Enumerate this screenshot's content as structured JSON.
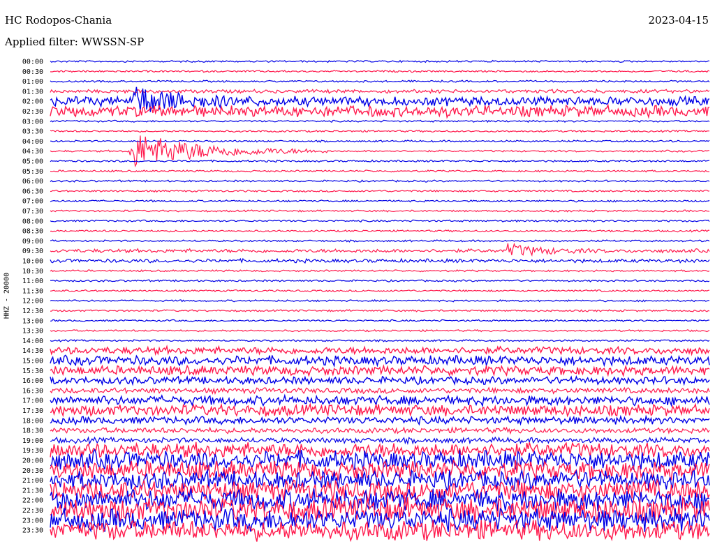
{
  "header": {
    "station": "HC Rodopos-Chania",
    "date": "2023-04-15",
    "filter": "Applied filter: WWSSN-SP",
    "channel": "HHZ - 20000"
  },
  "colors": {
    "odd": "#0000e6",
    "even": "#ff1a4d"
  },
  "chart_data": {
    "type": "helicorder",
    "title": "HC Rodopos-Chania",
    "date": "2023-04-15",
    "filter": "WWSSN-SP",
    "ylabel": "HHZ - 20000",
    "row_minutes": 30,
    "y_tick_labels": [
      "00:00",
      "00:30",
      "01:00",
      "01:30",
      "02:00",
      "02:30",
      "03:00",
      "03:30",
      "04:00",
      "04:30",
      "05:00",
      "05:30",
      "06:00",
      "06:30",
      "07:00",
      "07:30",
      "08:00",
      "08:30",
      "09:00",
      "09:30",
      "10:00",
      "10:30",
      "11:00",
      "11:30",
      "12:00",
      "12:30",
      "13:00",
      "13:30",
      "14:00",
      "14:30",
      "15:00",
      "15:30",
      "16:00",
      "16:30",
      "17:00",
      "17:30",
      "18:00",
      "18:30",
      "19:00",
      "19:30",
      "20:00",
      "20:30",
      "21:00",
      "21:30",
      "22:00",
      "22:30",
      "23:00",
      "23:30"
    ],
    "row_noise_level": [
      1,
      1,
      1,
      2,
      5,
      6,
      1,
      1,
      1,
      1,
      1,
      1,
      1,
      1,
      1,
      1,
      1,
      1,
      1,
      2,
      2,
      1,
      1,
      1,
      1,
      1,
      1,
      1,
      1,
      4,
      5,
      5,
      4,
      3,
      5,
      6,
      4,
      3,
      3,
      8,
      10,
      10,
      10,
      11,
      12,
      13,
      12,
      11
    ],
    "events": [
      {
        "row": 4,
        "minute": 3.8,
        "duration_min": 2,
        "amplitude": 18
      },
      {
        "row": 9,
        "minute": 3.6,
        "duration_min": 3,
        "amplitude": 28
      },
      {
        "row": 19,
        "minute": 20.8,
        "duration_min": 1.5,
        "amplitude": 9
      }
    ]
  }
}
